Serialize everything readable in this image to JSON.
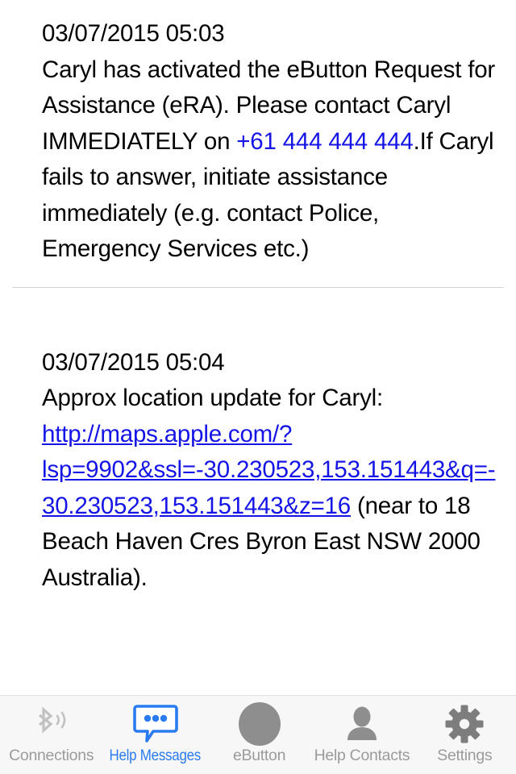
{
  "app": {
    "screen_title": "Help Messages"
  },
  "messages": [
    {
      "timestamp": "03/07/2015 05:03",
      "text_before_link": "Caryl has activated the eButton Request for Assistance (eRA). Please contact Caryl IMMEDIATELY on ",
      "phone_link": "+61 444 444 444",
      "text_after_link": ".If Caryl fails to answer, initiate assistance immediately (e.g. contact Police, Emergency Services etc.)"
    },
    {
      "timestamp": "03/07/2015 05:04",
      "text_before_link": "Approx location update for Caryl: ",
      "url_link": "http://maps.apple.com/?lsp=9902&ssl=-30.230523,153.151443&q=-30.230523,153.151443&z=16",
      "text_after_link": " (near to 18 Beach Haven Cres Byron East NSW 2000 Australia)."
    }
  ],
  "tab_bar": {
    "active_index": 1,
    "items": [
      {
        "label": "Connections",
        "icon": "bluetooth-signal-icon",
        "active": false
      },
      {
        "label": "Help Messages",
        "icon": "speech-bubble-icon",
        "active": true
      },
      {
        "label": "eButton",
        "icon": "filled-circle-icon",
        "active": false
      },
      {
        "label": "Help Contacts",
        "icon": "person-icon",
        "active": false
      },
      {
        "label": "Settings",
        "icon": "gear-icon",
        "active": false
      }
    ]
  },
  "colors": {
    "link_blue": "#1414e6",
    "tab_active_blue": "#2a7bf0",
    "tab_inactive_gray": "#9b9b9b",
    "tab_bar_background": "#f7f7f7",
    "divider": "#d4d4d4",
    "text": "#000000"
  }
}
